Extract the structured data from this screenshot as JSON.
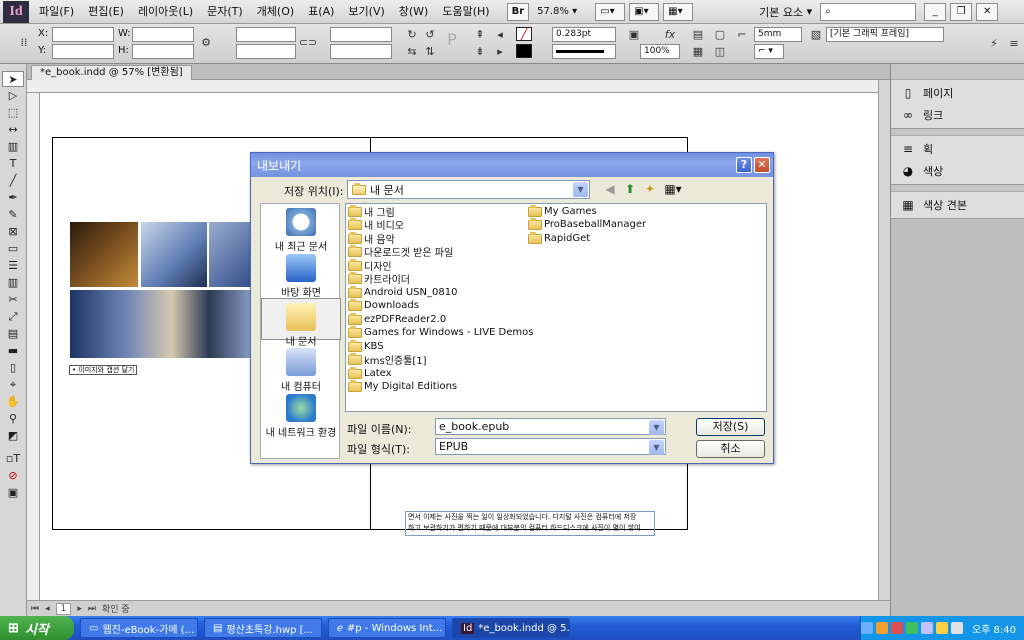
{
  "app": {
    "logo": "Id"
  },
  "menubar": {
    "items": [
      "파일(F)",
      "편집(E)",
      "레이아웃(L)",
      "문자(T)",
      "개체(O)",
      "표(A)",
      "보기(V)",
      "창(W)",
      "도움말(H)"
    ],
    "br_label": "Br",
    "zoom": "57.8%",
    "workspace": "기본 요소"
  },
  "control": {
    "x_label": "X:",
    "y_label": "Y:",
    "w_label": "W:",
    "h_label": "H:",
    "stroke_weight": "0.283pt",
    "opacity": "100%",
    "offset": "5mm",
    "frame_style": "[기본 그래픽 프레임]"
  },
  "document": {
    "tab_title": "*e_book.indd @ 57% [변환됨]",
    "caption": "• 이미지와 캡션 달기",
    "body_text": [
      "면서 이제는 사진을 찍는 일이 일상화되었습니다. 디지털 사진은 컴퓨터에 저장",
      "하고 보관하기가 편하기 때문에 대부분의 컴퓨터 하드디스크에 사진이 몇이 쌓여"
    ],
    "status_page": "1",
    "status_text": "확인 중"
  },
  "panels": {
    "group1": [
      {
        "icon": "pages-icon",
        "label": "페이지"
      },
      {
        "icon": "links-icon",
        "label": "링크"
      }
    ],
    "group2": [
      {
        "icon": "stroke-icon",
        "label": "획"
      },
      {
        "icon": "color-icon",
        "label": "색상"
      }
    ],
    "group3": [
      {
        "icon": "swatches-icon",
        "label": "색상 견본"
      }
    ]
  },
  "dialog": {
    "title": "내보내기",
    "location_label": "저장 위치(I):",
    "location_value": "내 문서",
    "places": [
      "내 최근 문서",
      "바탕 화면",
      "내 문서",
      "내 컴퓨터",
      "내 네트워크 환경"
    ],
    "files_col1": [
      "내 그림",
      "내 비디오",
      "내 음악",
      "다운로드겟 받은 파일",
      "디자인",
      "카트라이더",
      "Android USN_0810",
      "Downloads",
      "ezPDFReader2.0",
      "Games for Windows - LIVE Demos",
      "KBS",
      "kms인증툴[1]",
      "Latex",
      "My Digital Editions"
    ],
    "files_col2": [
      "My Games",
      "ProBaseballManager",
      "RapidGet"
    ],
    "filename_label": "파일 이름(N):",
    "filename_value": "e_book.epub",
    "filetype_label": "파일 형식(T):",
    "filetype_value": "EPUB",
    "save_button": "저장(S)",
    "cancel_button": "취소"
  },
  "taskbar": {
    "start_label": "시작",
    "items": [
      "웹진-eBook-가메 (...",
      "평산초특강.hwp [...",
      "#p - Windows Int...",
      "*e_book.indd @ 5..."
    ],
    "clock": "오후 8:40"
  }
}
